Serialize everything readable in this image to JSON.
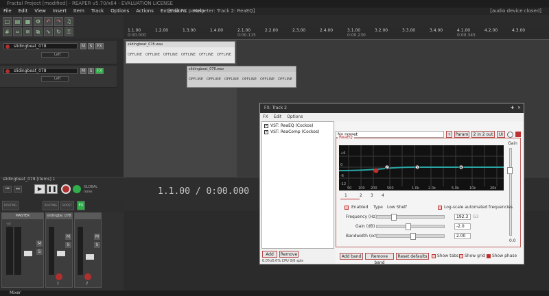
{
  "window": {
    "title": "Fractal Project [modified] - REAPER v5.70/x64 - EVALUATION LICENSE",
    "fx_param_title": "[Edit FX parameter: Track 2: ReaEQ]",
    "audio_status": "[audio device closed]"
  },
  "menu": [
    "File",
    "Edit",
    "View",
    "Insert",
    "Item",
    "Track",
    "Options",
    "Actions",
    "Extensions",
    "Help"
  ],
  "tracks": [
    {
      "name": "slidingbeat_078",
      "route_label": "Left"
    },
    {
      "name": "slidingbeat_078",
      "route_label": "Left"
    }
  ],
  "track_buttons": {
    "mute": "M",
    "solo": "S",
    "fx": "FX"
  },
  "ruler_labels": [
    "1.1.00",
    "1.2.00",
    "1.3.00",
    "1.4.00",
    "2.1.00",
    "2.2.00",
    "2.3.00",
    "2.4.00",
    "3.1.00",
    "3.2.00",
    "3.3.00",
    "3.4.00",
    "4.1.00",
    "4.2.00",
    "4.3.00"
  ],
  "ruler_times": [
    "0:00.000",
    "0:00.115",
    "0:00.230",
    "0:00.345",
    "0:00.461",
    "0:00.576",
    "0:00.691"
  ],
  "media_items": [
    {
      "name": "slidingbeat_078.wav",
      "offline": [
        "OFFLINE",
        "OFFLINE",
        "OFFLINE",
        "OFFLINE",
        "OFFLINE",
        "OFFLINE"
      ]
    },
    {
      "name": "slidingbeat_078.wav",
      "offline": [
        "OFFLINE",
        "OFFLINE",
        "OFFLINE",
        "OFFLINE",
        "OFFLINE",
        "OFFLINE"
      ]
    }
  ],
  "transport": {
    "position": "1.1.00 / 0:00.000",
    "selection_prefix": "[S",
    "project_label": "slidingbeat_078 [items] 1",
    "global": "GLOBAL",
    "none": "none"
  },
  "mixer": {
    "strips": [
      {
        "name": "MASTER",
        "number": ""
      },
      {
        "name": "slidingbe..078",
        "number": "1"
      },
      {
        "name": "",
        "number": "2"
      }
    ],
    "routing": "ROUTING",
    "boost": "BOOST",
    "vol_label": "-inf"
  },
  "statusbar": {
    "label": "Mixer"
  },
  "fx_window": {
    "title": "FX: Track 2",
    "menu": [
      "FX",
      "Edit",
      "Options"
    ],
    "chain": [
      {
        "label": "VST: ReaEQ (Cockos)",
        "checked": true
      },
      {
        "label": "VST: ReaComp (Cockos)",
        "checked": true
      }
    ],
    "add_label": "Add",
    "remove_label": "Remove",
    "cpu": "0.0%/0.0% CPU 0/0 spls",
    "preset": "No preset",
    "plus": "+",
    "param_label": "Param",
    "io_label": "2 in 2 out",
    "ui_label": "UI",
    "plugin_title": "ReaEQ",
    "gain_label": "Gain",
    "gain_value": "0.0",
    "db_labels": [
      "+6",
      "0",
      "-6",
      "-12"
    ],
    "freq_labels": [
      "50",
      "100",
      "200",
      "500",
      "1.0k",
      "2.0k",
      "5.0k",
      "10k",
      "20k"
    ],
    "bands": [
      "1",
      "2",
      "3",
      "4"
    ],
    "enabled_label": "Enabled",
    "type_label": "Type",
    "type_value": "Low Shelf",
    "logscale_label": "Log-scale automated frequencies",
    "frequency_label": "Frequency (Hz)",
    "frequency_value": "192.3",
    "frequency_unit": "G3",
    "gain_db_label": "Gain (dB)",
    "gain_db_value": "-2.0",
    "bandwidth_label": "Bandwidth (oct)",
    "bandwidth_value": "2.00",
    "add_band": "Add band",
    "remove_band": "Remove band",
    "reset_defaults": "Reset defaults",
    "show_tabs": "Show tabs",
    "show_grid": "Show grid",
    "show_phase": "Show phase"
  },
  "colors": {
    "accent_red": "#c03030",
    "eq_curve": "#2aa6a6",
    "record": "#b03030",
    "fx_green": "#2fae4a"
  }
}
